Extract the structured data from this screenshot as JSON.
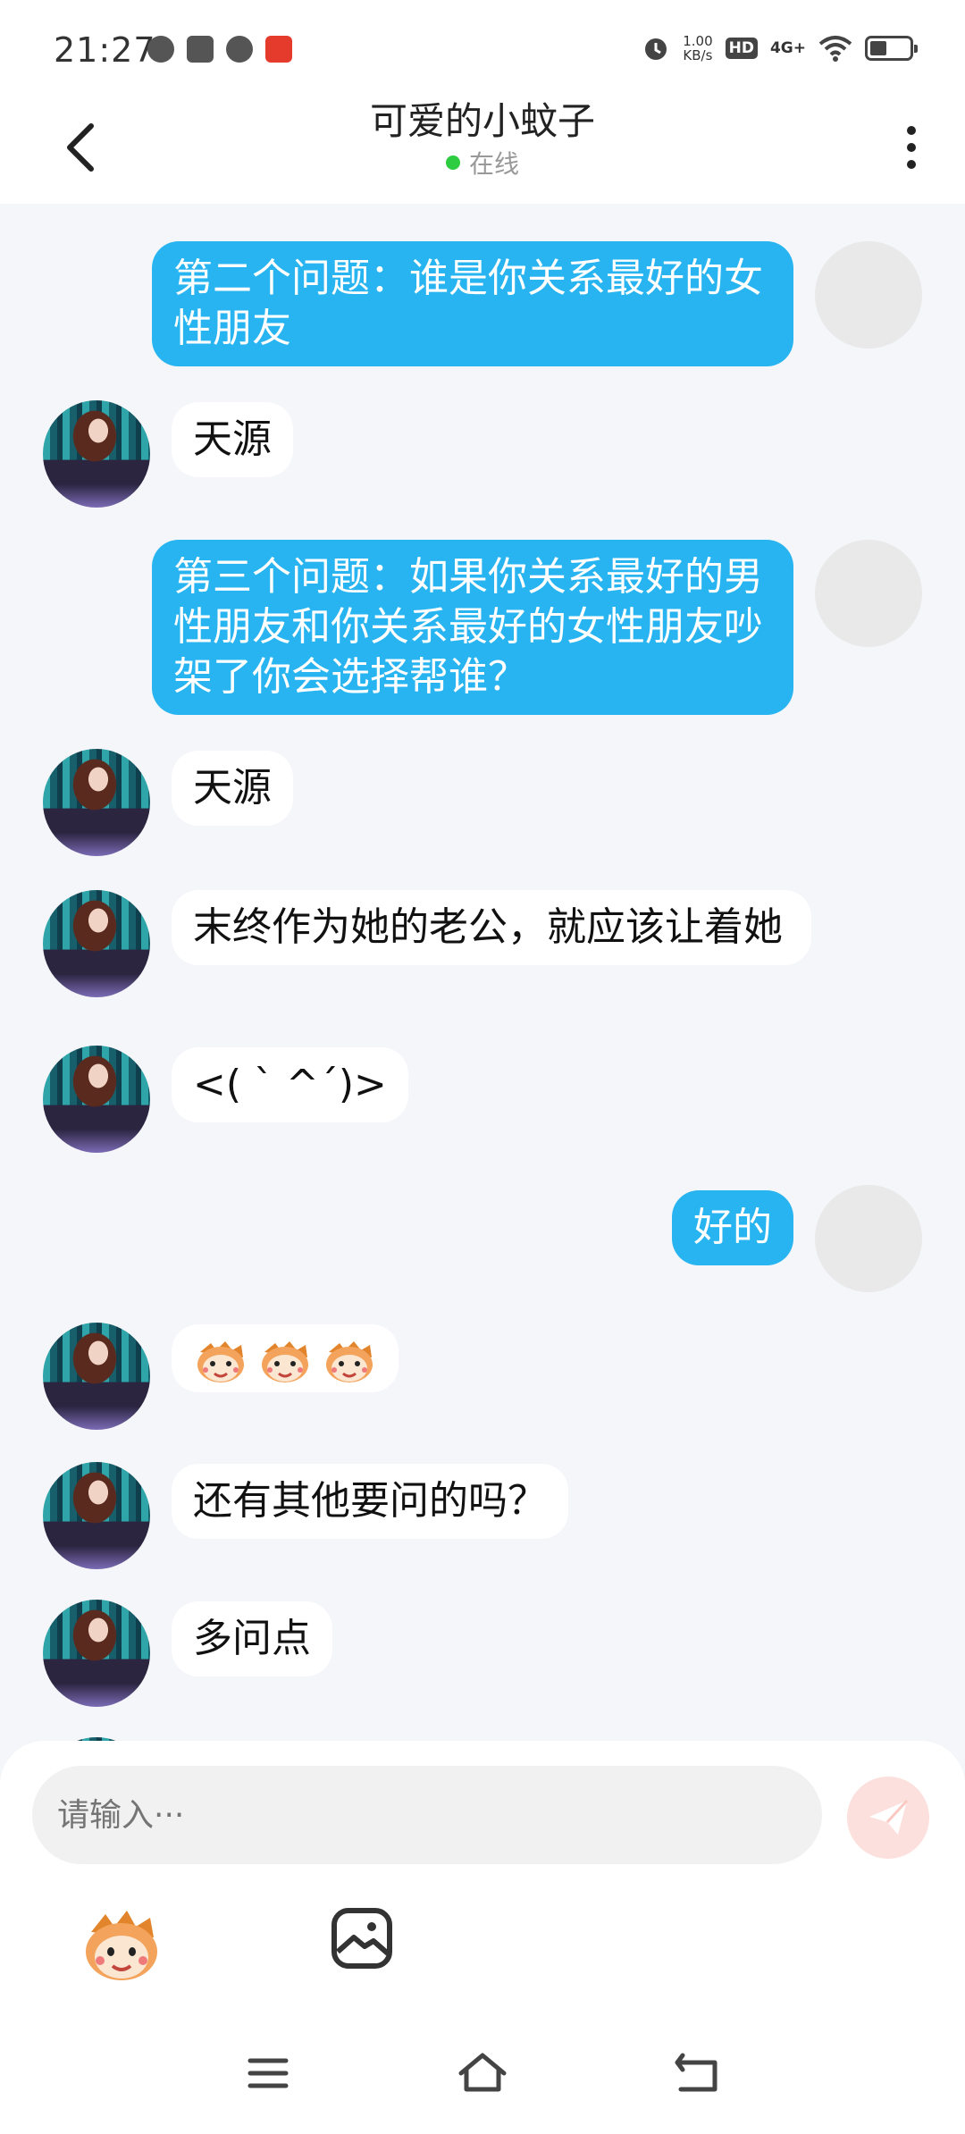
{
  "status_bar": {
    "time": "21:27",
    "speed_value": "1.00",
    "speed_unit": "KB/s",
    "hd_badge": "HD",
    "network": "4G+"
  },
  "header": {
    "title": "可爱的小蚊子",
    "status": "在线"
  },
  "messages": [
    {
      "from": "me",
      "text": "第二个问题：谁是你关系最好的女性朋友"
    },
    {
      "from": "her",
      "text": "天源"
    },
    {
      "from": "me",
      "text": "第三个问题：如果你关系最好的男性朋友和你关系最好的女性朋友吵架了你会选择帮谁？"
    },
    {
      "from": "her",
      "text": "天源"
    },
    {
      "from": "her",
      "text": "末终作为她的老公，就应该让着她"
    },
    {
      "from": "her",
      "text": "<( ` ^´)>"
    },
    {
      "from": "me",
      "text": "好的"
    },
    {
      "from": "her",
      "stickers": [
        "monkey-face",
        "monkey-face",
        "monkey-face"
      ]
    },
    {
      "from": "her",
      "text": "还有其他要问的吗？"
    },
    {
      "from": "her",
      "text": "多问点"
    }
  ],
  "input": {
    "placeholder": "请输入···"
  },
  "icons": {
    "back": "chevron-left-icon",
    "more": "more-vertical-icon",
    "send": "send-icon",
    "emoji": "monkey-emoji-icon",
    "image": "image-icon"
  },
  "colors": {
    "my_bubble": "#27b4f0",
    "her_bubble": "#ffffff",
    "online": "#2ecc40",
    "background": "#f4f6f9"
  }
}
